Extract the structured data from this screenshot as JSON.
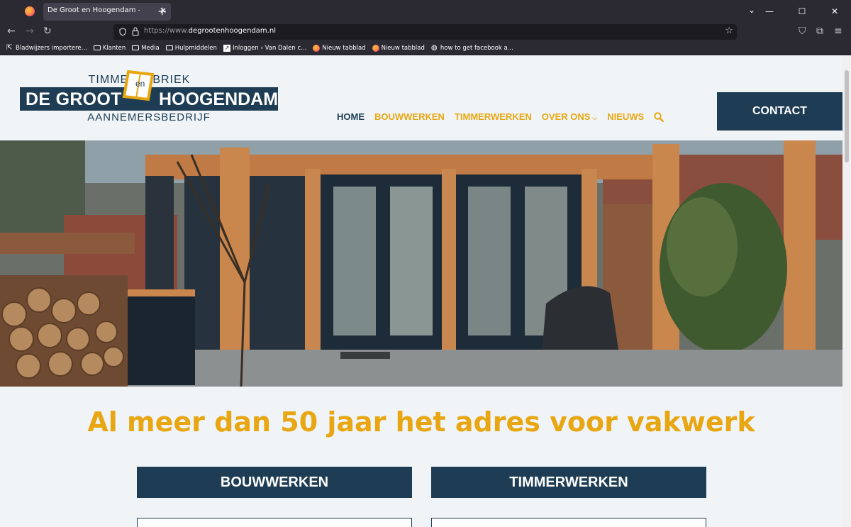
{
  "browser": {
    "tab_title": "De Groot en Hoogendam – Aannem",
    "url_prefix": "https://www.",
    "url_domain": "degrootenhoogendam.nl",
    "bookmarks": [
      {
        "label": "Bladwijzers importere...",
        "icon": "import-icon"
      },
      {
        "label": "Klanten",
        "icon": "folder-icon"
      },
      {
        "label": "Media",
        "icon": "folder-icon"
      },
      {
        "label": "Hulpmiddelen",
        "icon": "folder-icon"
      },
      {
        "label": "Inloggen ‹ Van Dalen c...",
        "icon": "site-icon"
      },
      {
        "label": "Nieuw tabblad",
        "icon": "firefox-icon"
      },
      {
        "label": "Nieuw tabblad",
        "icon": "firefox-icon"
      },
      {
        "label": "how to get facebook a...",
        "icon": "globe-icon"
      }
    ]
  },
  "site": {
    "logo_top": "TIMMERFABRIEK",
    "logo_left": "DE GROOT",
    "logo_en": "en",
    "logo_right": "HOOGENDAM",
    "logo_bottom": "AANNEMERSBEDRIJF",
    "menu": {
      "home": "HOME",
      "bouwwerken": "BOUWWERKEN",
      "timmerwerken": "TIMMERWERKEN",
      "over_ons": "OVER ONS",
      "nieuws": "NIEUWS"
    },
    "contact": "CONTACT",
    "headline": "Al meer dan 50 jaar het adres voor vakwerk",
    "categories": [
      "BOUWWERKEN",
      "TIMMERWERKEN"
    ],
    "colors": {
      "navy": "#1e3d54",
      "gold": "#e8a712",
      "background": "#f0f4f7"
    }
  }
}
